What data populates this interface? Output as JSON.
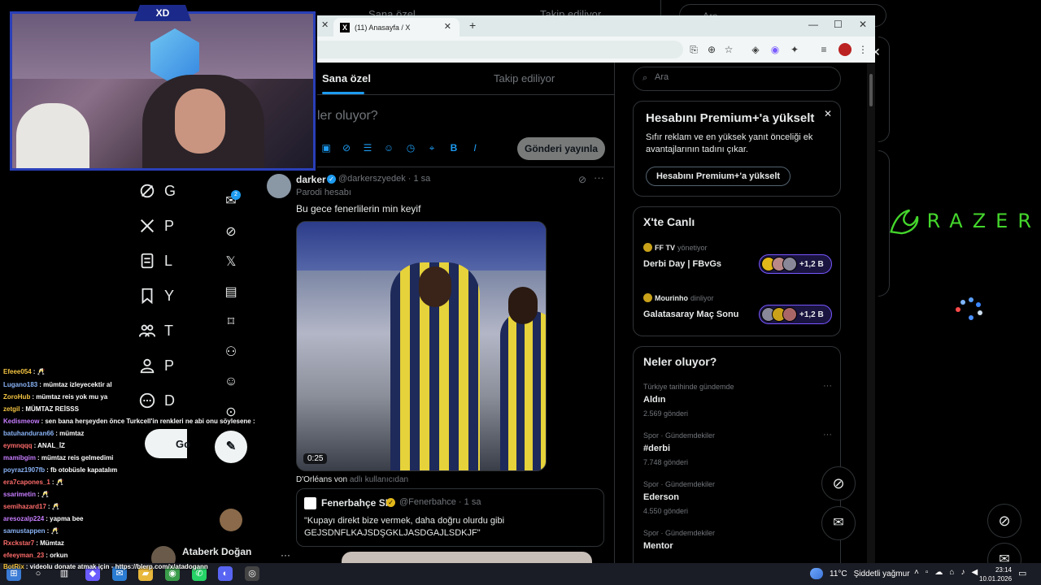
{
  "background_page": {
    "search_placeholder": "Ara",
    "tab_sana": "Sana özel",
    "tab_takip": "Takip ediliyor",
    "nav_items": [
      "G",
      "P",
      "L",
      "Y",
      "T",
      "P",
      "D"
    ],
    "post_button": "Go",
    "profile_name": "Ataberk Doğan",
    "profile_more": "···",
    "close": "✕",
    "razer_text": "RAZER"
  },
  "webcam": {
    "badge": "XD"
  },
  "browser": {
    "tab_title": "(11) Anasayfa / X",
    "tab_icon": "X",
    "new_tab": "+",
    "close_prev": "✕",
    "tab_close": "✕",
    "minimize": "—",
    "maximize": "☐",
    "close": "✕",
    "toolbar_icons": [
      "install-icon",
      "zoom-icon",
      "star-icon",
      "extension-icon",
      "extension2-icon",
      "puzzle-icon",
      "reading-list-icon",
      "profile-icon",
      "menu-icon"
    ]
  },
  "x": {
    "tabs": {
      "sana": "Sana özel",
      "takip": "Takip ediliyor"
    },
    "compose_placeholder": "ler oluyor?",
    "post_button": "Gönderi yayınla",
    "messages_badge": "2",
    "tweet": {
      "name": "darker",
      "handle": "@darkerszyedek · 1 sa",
      "parody": "Parodi hesabı",
      "text": "Bu gece fenerlilerin min keyif",
      "duration": "0:25",
      "source_name": "D'Orléans von",
      "source_suffix": "adlı kullanıcıdan",
      "quote": {
        "name": "Fenerbahçe SK",
        "handle": "@Fenerbahce · 1 sa",
        "text": "\"Kupayı direkt bize vermek, daha doğru olurdu gibi GEJSDNFLKAJSDŞGKLJASDGAJLSDKJF\""
      }
    },
    "search_placeholder": "Ara",
    "premium": {
      "title": "Hesabını Premium+'a yükselt",
      "desc": "Sıfır reklam ve en yüksek yanıt önceliği ek avantajlarının tadını çıkar.",
      "button": "Hesabını Premium+'a yükselt",
      "close": "✕"
    },
    "live": {
      "title": "X'te Canlı",
      "items": [
        {
          "host": "FF TV",
          "role": "yönetiyor",
          "title": "Derbi Day | FBvGs",
          "count": "+1,2 B"
        },
        {
          "host": "Mourinho",
          "role": "dinliyor",
          "title": "Galatasaray Maç Sonu",
          "count": "+1,2 B"
        }
      ]
    },
    "trends": {
      "title": "Neler oluyor?",
      "items": [
        {
          "cat": "Türkiye tarihinde gündemde",
          "name": "Aldın",
          "count": "2.569 gönderi"
        },
        {
          "cat": "Spor · Gündemdekiler",
          "name": "#derbi",
          "count": "7.748 gönderi"
        },
        {
          "cat": "Spor · Gündemdekiler",
          "name": "Ederson",
          "count": "4.550 gönderi"
        },
        {
          "cat": "Spor · Gündemdekiler",
          "name": "Mentor",
          "count": ""
        }
      ],
      "more": "···"
    }
  },
  "chat": [
    {
      "user": "Efeee054",
      "color": "#f5c542",
      "msg": ": 🥂"
    },
    {
      "user": "Lugano183",
      "color": "#8ab4f8",
      "msg": ": mümtaz izleyecektir al"
    },
    {
      "user": "ZoroHub",
      "color": "#f5c542",
      "msg": ": mümtaz reis yok mu ya"
    },
    {
      "user": "zetgil",
      "color": "#f5c542",
      "msg": ": MÜMTAZ REİSSS"
    },
    {
      "user": "Kedismeow",
      "color": "#c77dff",
      "msg": ": sen bana herşeyden önce Turkcell'in renkleri ne abi onu söylesene :"
    },
    {
      "user": "batuhanduran66",
      "color": "#8ab4f8",
      "msg": ": mümtaz"
    },
    {
      "user": "eymnqqq",
      "color": "#ff6b6b",
      "msg": ": ANAL_İZ"
    },
    {
      "user": "mamibgim",
      "color": "#c77dff",
      "msg": ": mümtaz reis gelmedimi"
    },
    {
      "user": "poyraz1907fb",
      "color": "#8ab4f8",
      "msg": ": fb otobüsle kapatalım"
    },
    {
      "user": "era7capones_1",
      "color": "#ff6b6b",
      "msg": ": 🥂"
    },
    {
      "user": "ssarimetin",
      "color": "#c77dff",
      "msg": ": 🥂"
    },
    {
      "user": "semihazard17",
      "color": "#ff6b6b",
      "msg": ": 🥂"
    },
    {
      "user": "aresozalp224",
      "color": "#c77dff",
      "msg": ": yapma bee"
    },
    {
      "user": "samustappen",
      "color": "#8ab4f8",
      "msg": ": 🥂"
    },
    {
      "user": "Rxckstar7",
      "color": "#ff6b6b",
      "msg": ": Mümtaz"
    },
    {
      "user": "efeeyman_23",
      "color": "#ff6b6b",
      "msg": ": orkun"
    },
    {
      "user": "BotRix",
      "color": "#f5c542",
      "msg": ": videolu donate atmak için - https://blerp.com/x/atadogann"
    }
  ],
  "taskbar": {
    "weather_temp": "11°C",
    "weather_desc": "Şiddetli yağmur",
    "time": "23:14",
    "date": "10.01.2026"
  }
}
